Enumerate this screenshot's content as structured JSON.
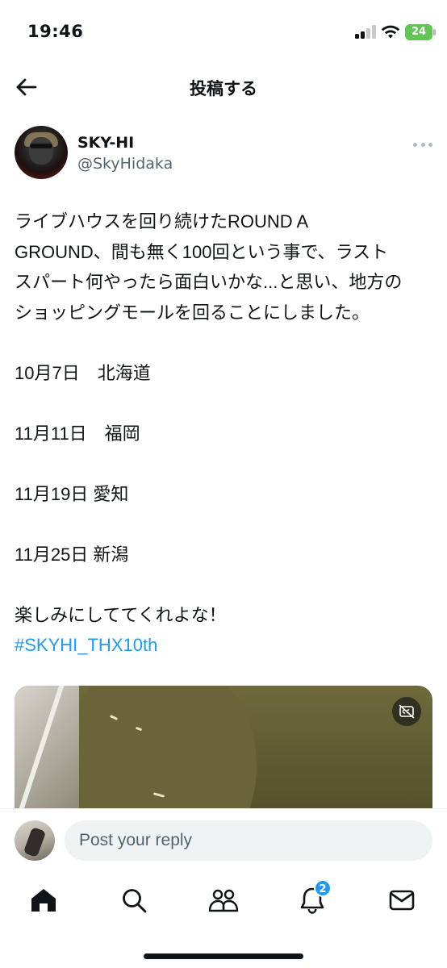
{
  "status_bar": {
    "time": "19:46",
    "battery": "24"
  },
  "header": {
    "title": "投稿する"
  },
  "author": {
    "display_name": "SKY-HI",
    "handle": "@SkyHidaka"
  },
  "post": {
    "lines": [
      "ライブハウスを回り続けたROUND A",
      "GROUND、間も無く100回という事で、ラスト",
      "スパート何やったら面白いかな...と思い、地方の",
      "ショッピングモールを回ることにしました。"
    ],
    "schedule": [
      "10月7日　北海道",
      "11月11日　福岡",
      "11月19日 愛知",
      "11月25日 新潟"
    ],
    "closing": "楽しみにしててくれよな！",
    "hashtag": "#SKYHI_THX10th"
  },
  "reply": {
    "placeholder": "Post your reply"
  },
  "tabs": {
    "notifications_badge": "2"
  },
  "colors": {
    "accent": "#1d9bf0",
    "text": "#0f1419",
    "secondary": "#536471",
    "battery": "#61c554"
  },
  "icons": [
    "back-arrow-icon",
    "more-icon",
    "captions-off-icon",
    "home-icon",
    "search-icon",
    "communities-icon",
    "notifications-icon",
    "messages-icon"
  ]
}
